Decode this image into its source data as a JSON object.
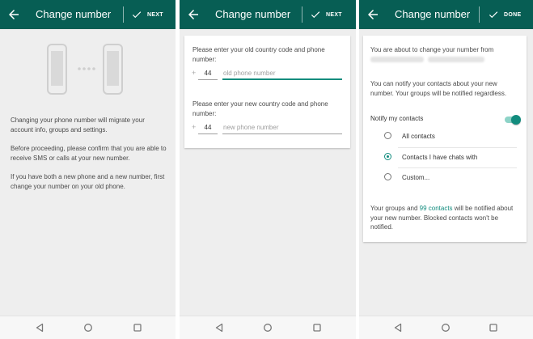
{
  "colors": {
    "appbar": "#075e54",
    "accent": "#128c7e",
    "background": "#eeeeee"
  },
  "screen1": {
    "title": "Change number",
    "action_label": "NEXT",
    "illustration": "two-phones-icon",
    "para1": "Changing your phone number will migrate your account info, groups and settings.",
    "para2": "Before proceeding, please confirm that you are able to receive SMS or calls at your new number.",
    "para3": "If you have both a new phone and a new number, first change your number on your old phone."
  },
  "screen2": {
    "title": "Change number",
    "action_label": "NEXT",
    "old_label": "Please enter your old country code and phone number:",
    "old_code": "44",
    "old_placeholder": "old phone number",
    "new_label": "Please enter your new country code and phone number:",
    "new_code": "44",
    "new_placeholder": "new phone number",
    "plus": "+"
  },
  "screen3": {
    "title": "Change number",
    "action_label": "DONE",
    "intro": "You are about to change your number from",
    "notify_info": "You can notify your contacts about your new number. Your groups will be notified regardless.",
    "notify_label": "Notify my contacts",
    "notify_on": true,
    "options": [
      "All contacts",
      "Contacts I have chats with",
      "Custom..."
    ],
    "selected_option": 1,
    "footer_pre": "Your groups and ",
    "footer_link": "99 contacts",
    "footer_post": " will be notified about your new number. Blocked contacts won't be notified."
  },
  "navbar_icons": [
    "back-triangle-icon",
    "home-circle-icon",
    "recents-square-icon"
  ]
}
